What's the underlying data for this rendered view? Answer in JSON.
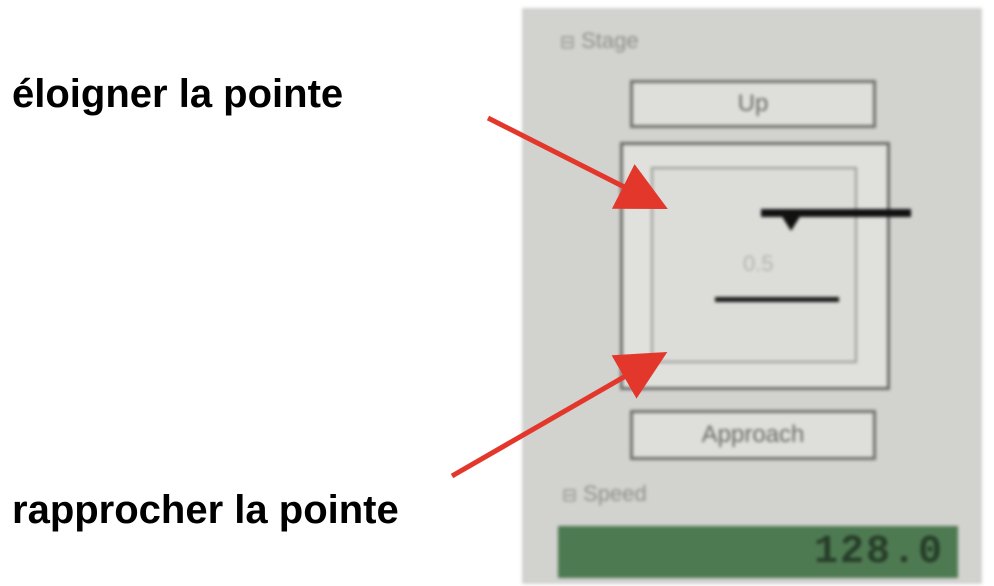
{
  "annotations": {
    "move_away": "éloigner la pointe",
    "move_closer": "rapprocher la pointe"
  },
  "panel": {
    "stage_label": "Stage",
    "top_button": "Up",
    "stage_readout": "0.5",
    "approach_button": "Approach",
    "speed_label": "Speed",
    "speed_value": "128.0"
  },
  "colors": {
    "arrow": "#e3372b",
    "panel_bg": "#d2d2cf",
    "lcd_bg": "#4e7a52"
  },
  "icons": {
    "collapse": "collapse-icon",
    "tip_marker": "triangle-down-icon"
  }
}
